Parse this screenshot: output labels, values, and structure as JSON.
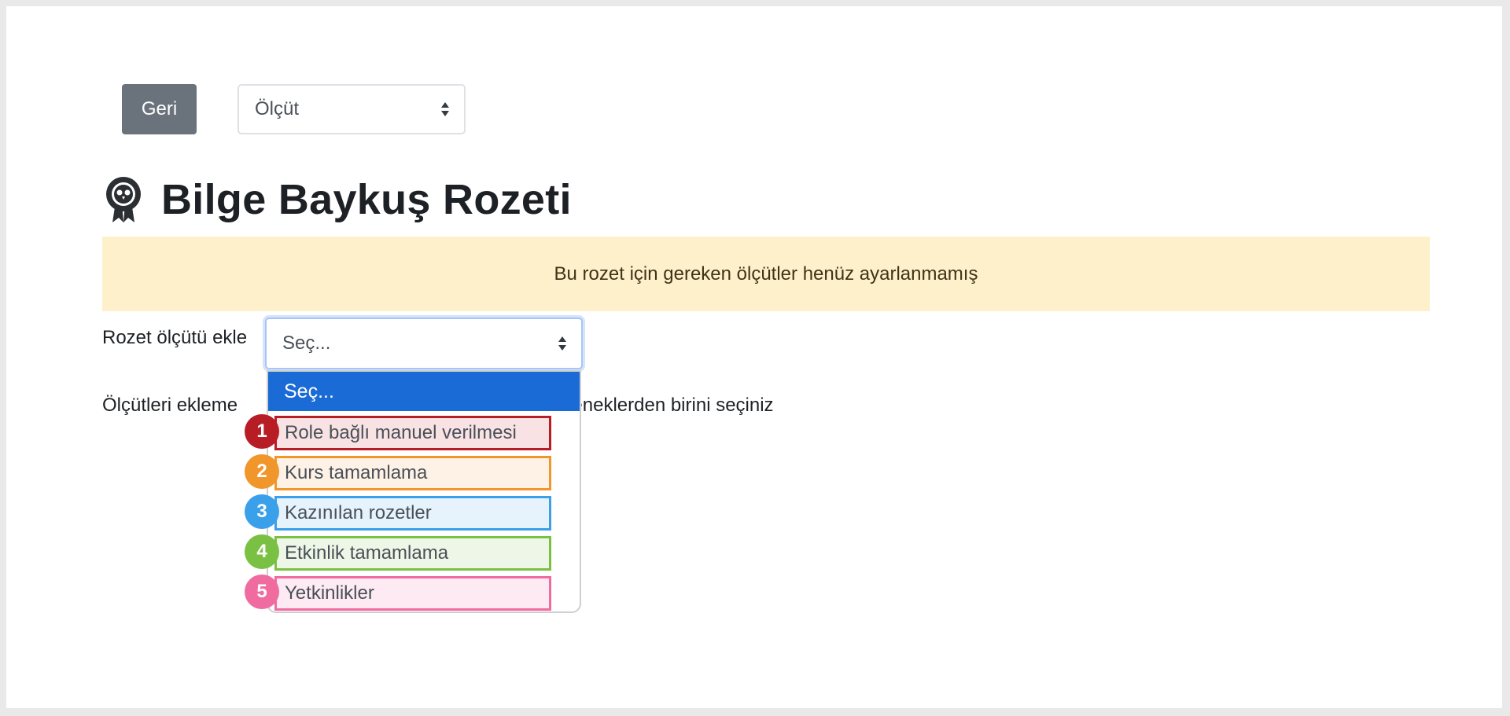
{
  "toolbar": {
    "back_label": "Geri",
    "criteria_select_value": "Ölçüt"
  },
  "badge": {
    "title": "Bilge Baykuş Rozeti"
  },
  "alert": {
    "text": "Bu rozet için gereken ölçütler henüz ayarlanmamış"
  },
  "add_criteria": {
    "label": "Rozet ölçütü ekle",
    "select_value": "Seç...",
    "info_prefix": "Ölçütleri ekleme",
    "info_suffix": "eçeneklerden birini seçiniz",
    "dropdown": {
      "selected": "Seç...",
      "options": [
        {
          "number": "1",
          "label": "Role bağlı manuel verilmesi",
          "color": "#b81c25",
          "bg": "#f8e2e3"
        },
        {
          "number": "2",
          "label": "Kurs tamamlama",
          "color": "#f0962a",
          "bg": "#fef1e5"
        },
        {
          "number": "3",
          "label": "Kazınılan rozetler",
          "color": "#3aa0ea",
          "bg": "#e6f3fd"
        },
        {
          "number": "4",
          "label": "Etkinlik tamamlama",
          "color": "#7ac143",
          "bg": "#eef7e7"
        },
        {
          "number": "5",
          "label": "Yetkinlikler",
          "color": "#f06ba0",
          "bg": "#fdeaf2"
        }
      ]
    }
  },
  "colors": {
    "back_button": "#6a737b",
    "alert_bg": "#fff0cc",
    "dropdown_selected": "#1b6bd6"
  }
}
